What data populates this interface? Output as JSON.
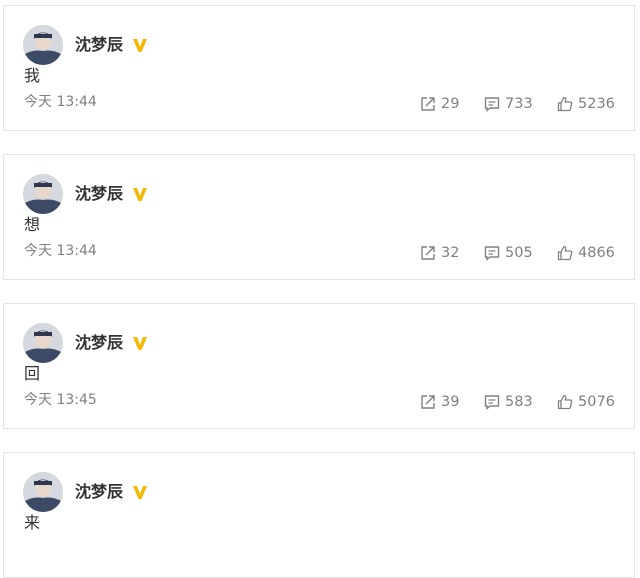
{
  "colors": {
    "verified_badge": "#f5b800",
    "meta_text": "#808080",
    "card_border": "#e3e3e3"
  },
  "posts": [
    {
      "author": "沈梦辰",
      "text": "我",
      "time": "今天 13:44",
      "shares": "29",
      "comments": "733",
      "likes": "5236"
    },
    {
      "author": "沈梦辰",
      "text": "想",
      "time": "今天 13:44",
      "shares": "32",
      "comments": "505",
      "likes": "4866"
    },
    {
      "author": "沈梦辰",
      "text": "回",
      "time": "今天 13:45",
      "shares": "39",
      "comments": "583",
      "likes": "5076"
    },
    {
      "author": "沈梦辰",
      "text": "来",
      "time": "",
      "shares": "",
      "comments": "",
      "likes": ""
    }
  ],
  "icons": {
    "verified": "verified-v-badge-icon",
    "share": "share-icon",
    "comment": "comment-icon",
    "like": "thumbs-up-icon"
  }
}
